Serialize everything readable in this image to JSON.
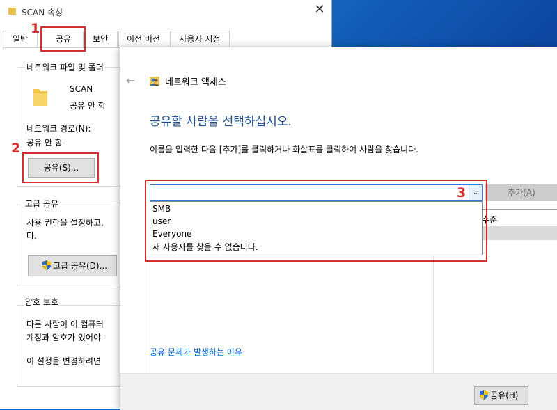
{
  "props_window": {
    "title": "SCAN 속성",
    "close_glyph": "✕",
    "tabs": [
      "일반",
      "공유",
      "보안",
      "이전 버전",
      "사용자 지정"
    ],
    "network_group_label": "네트워크 파일 및 폴더",
    "folder_name": "SCAN",
    "folder_status": "공유 안 함",
    "network_path_label": "네트워크 경로(N):",
    "network_path_value": "공유 안 함",
    "share_button": "공유(S)...",
    "advanced_group_label": "고급 공유",
    "advanced_text_1": "사용 권한을 설정하고,",
    "advanced_text_2": "다.",
    "advanced_button": "고급 공유(D)...",
    "password_group_label": "암호 보호",
    "password_text_1": "다른 사람이 이 컴퓨터",
    "password_text_2": "계정과 암호가 있어야",
    "password_text_3": "이 설정을 변경하려면"
  },
  "annotations": [
    "1",
    "2",
    "3"
  ],
  "dialog": {
    "back_glyph": "←",
    "title": "네트워크 액세스",
    "heading": "공유할 사람을 선택하십시오.",
    "instruction": "이름을 입력한 다음 [추가]를 클릭하거나 화살표를 클릭하여 사람을 찾습니다.",
    "combo_value": "",
    "combo_arrow_glyph": "⌄",
    "dropdown_options": [
      "SMB",
      "user",
      "Everyone",
      "새 사용자를 찾을 수 없습니다."
    ],
    "add_button": "추가(A)",
    "list_column_header": "수준",
    "help_link": "공유 문제가 발생하는 이유",
    "share_button": "공유(H)"
  },
  "colors": {
    "annotation_red": "#d32f2f",
    "heading_blue": "#1e4e8c",
    "link_blue": "#0066cc",
    "desktop_blue": "#1565c0"
  }
}
